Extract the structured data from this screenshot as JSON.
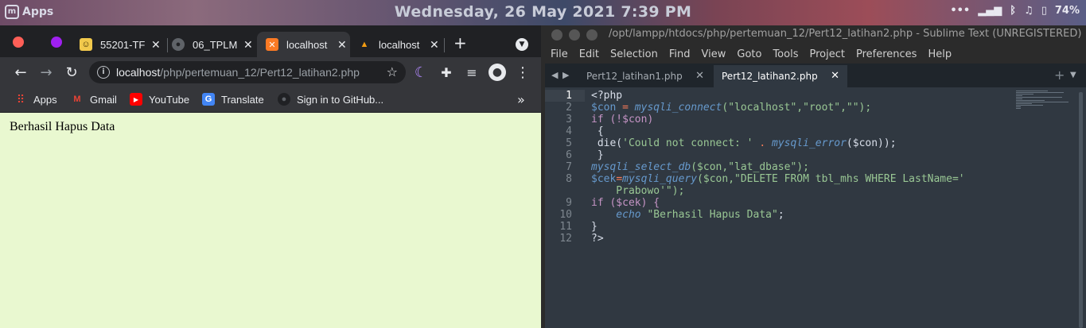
{
  "panel": {
    "apps_label": "Apps",
    "clock": "Wednesday, 26 May 2021  7:39 PM",
    "battery": "74%"
  },
  "chrome": {
    "tabs": [
      {
        "label": "55201-TF",
        "active": false
      },
      {
        "label": "06_TPLM",
        "active": false
      },
      {
        "label": "localhost",
        "active": true
      },
      {
        "label": "localhost",
        "active": false
      }
    ],
    "address": {
      "host": "localhost",
      "path": "/php/pertemuan_12/Pert12_latihan2.php"
    },
    "bookmarks": [
      {
        "label": "Apps",
        "icon": "apps-grid-icon"
      },
      {
        "label": "Gmail",
        "icon": "gmail-icon"
      },
      {
        "label": "YouTube",
        "icon": "youtube-icon"
      },
      {
        "label": "Translate",
        "icon": "translate-icon"
      },
      {
        "label": "Sign in to GitHub...",
        "icon": "github-icon"
      }
    ],
    "page_text": "Berhasil Hapus Data"
  },
  "sublime": {
    "title": "/opt/lampp/htdocs/php/pertemuan_12/Pert12_latihan2.php - Sublime Text (UNREGISTERED)",
    "menu": [
      "File",
      "Edit",
      "Selection",
      "Find",
      "View",
      "Goto",
      "Tools",
      "Project",
      "Preferences",
      "Help"
    ],
    "tabs": [
      {
        "label": "Pert12_latihan1.php",
        "active": false
      },
      {
        "label": "Pert12_latihan2.php",
        "active": true
      }
    ],
    "line_numbers": [
      "1",
      "2",
      "3",
      "4",
      "5",
      "6",
      "7",
      "8",
      "9",
      "10",
      "11",
      "12"
    ],
    "current_line": "1",
    "code": {
      "l1": "<?php",
      "l2_var": "$con",
      "l2_eq": " = ",
      "l2_fn": "mysqli_connect",
      "l2_args": "(\"localhost\",\"root\",\"\");",
      "l3": "if (!$con)",
      "l4": " {",
      "l5_die": " die(",
      "l5_str": "'Could not connect: '",
      "l5_dot": " . ",
      "l5_fn": "mysqli_error",
      "l5_end": "($con));",
      "l6": " }",
      "l7_fn": "mysqli_select_db",
      "l7_args": "($con,\"lat_dbase\");",
      "l8_var": "$cek",
      "l8_eq": "=",
      "l8_fn": "mysqli_query",
      "l8_args": "($con,\"DELETE FROM tbl_mhs WHERE LastName='",
      "l8_cont": "    Prabowo'\");",
      "l9": "if ($cek) {",
      "l10_echo": "    echo",
      "l10_str": " \"Berhasil Hapus Data\"",
      "l10_end": ";",
      "l11": "}",
      "l12": "?>"
    }
  },
  "colors": {
    "chrome_bg": "#202124",
    "page_bg": "#e9f8d0",
    "sublime_bg": "#303841"
  }
}
